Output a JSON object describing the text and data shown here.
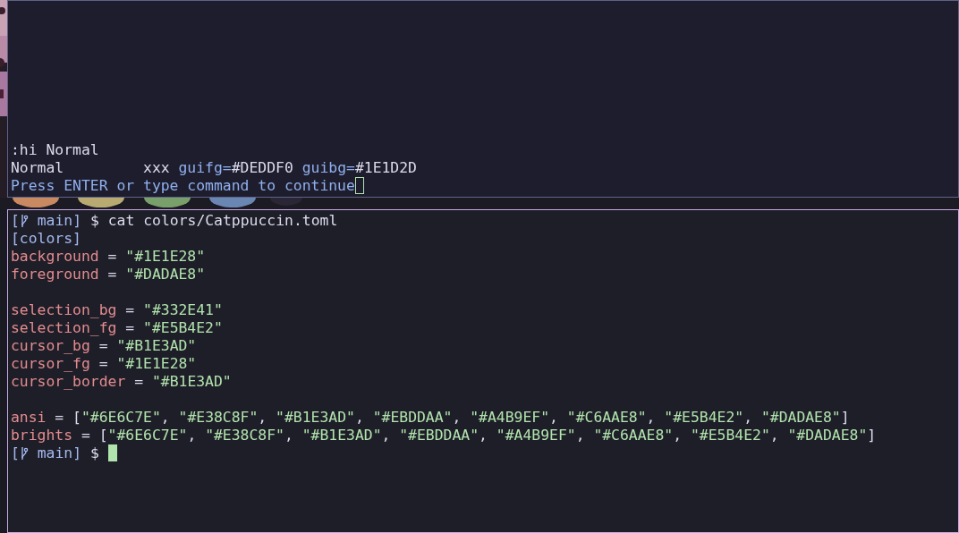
{
  "windows": [
    {
      "focused": false,
      "lines": [
        [
          {
            "kind": "plain",
            "text": ":hi Normal"
          }
        ],
        [
          {
            "kind": "plain",
            "text": "Normal         xxx "
          },
          {
            "kind": "attr",
            "text": "guifg="
          },
          {
            "kind": "plain",
            "text": "#DEDDF0 "
          },
          {
            "kind": "attr",
            "text": "guibg="
          },
          {
            "kind": "plain",
            "text": "#1E1D2D"
          }
        ],
        [
          {
            "kind": "attr",
            "text": "Press ENTER or type command to continue"
          },
          {
            "kind": "cursor"
          }
        ]
      ]
    },
    {
      "focused": true,
      "lines": [
        [
          {
            "kind": "prompt",
            "text": "["
          },
          {
            "kind": "branch"
          },
          {
            "kind": "prompt",
            "text": " main]"
          },
          {
            "kind": "plain",
            "text": " $ cat colors/Catppuccin.toml"
          }
        ],
        [
          {
            "kind": "section",
            "text": "[colors]"
          }
        ],
        [
          {
            "kind": "key",
            "text": "background"
          },
          {
            "kind": "plain",
            "text": " = "
          },
          {
            "kind": "string",
            "text": "\"#1E1E28\""
          }
        ],
        [
          {
            "kind": "key",
            "text": "foreground"
          },
          {
            "kind": "plain",
            "text": " = "
          },
          {
            "kind": "string",
            "text": "\"#DADAE8\""
          }
        ],
        [
          {
            "kind": "blank"
          }
        ],
        [
          {
            "kind": "key",
            "text": "selection_bg"
          },
          {
            "kind": "plain",
            "text": " = "
          },
          {
            "kind": "string",
            "text": "\"#332E41\""
          }
        ],
        [
          {
            "kind": "key",
            "text": "selection_fg"
          },
          {
            "kind": "plain",
            "text": " = "
          },
          {
            "kind": "string",
            "text": "\"#E5B4E2\""
          }
        ],
        [
          {
            "kind": "key",
            "text": "cursor_bg"
          },
          {
            "kind": "plain",
            "text": " = "
          },
          {
            "kind": "string",
            "text": "\"#B1E3AD\""
          }
        ],
        [
          {
            "kind": "key",
            "text": "cursor_fg"
          },
          {
            "kind": "plain",
            "text": " = "
          },
          {
            "kind": "string",
            "text": "\"#1E1E28\""
          }
        ],
        [
          {
            "kind": "key",
            "text": "cursor_border"
          },
          {
            "kind": "plain",
            "text": " = "
          },
          {
            "kind": "string",
            "text": "\"#B1E3AD\""
          }
        ],
        [
          {
            "kind": "blank"
          }
        ],
        [
          {
            "kind": "key",
            "text": "ansi"
          },
          {
            "kind": "plain",
            "text": " = ["
          },
          {
            "kind": "string",
            "text": "\"#6E6C7E\""
          },
          {
            "kind": "plain",
            "text": ", "
          },
          {
            "kind": "string",
            "text": "\"#E38C8F\""
          },
          {
            "kind": "plain",
            "text": ", "
          },
          {
            "kind": "string",
            "text": "\"#B1E3AD\""
          },
          {
            "kind": "plain",
            "text": ", "
          },
          {
            "kind": "string",
            "text": "\"#EBDDAA\""
          },
          {
            "kind": "plain",
            "text": ", "
          },
          {
            "kind": "string",
            "text": "\"#A4B9EF\""
          },
          {
            "kind": "plain",
            "text": ", "
          },
          {
            "kind": "string",
            "text": "\"#C6AAE8\""
          },
          {
            "kind": "plain",
            "text": ", "
          },
          {
            "kind": "string",
            "text": "\"#E5B4E2\""
          },
          {
            "kind": "plain",
            "text": ", "
          },
          {
            "kind": "string",
            "text": "\"#DADAE8\""
          },
          {
            "kind": "plain",
            "text": "]"
          }
        ],
        [
          {
            "kind": "key",
            "text": "brights"
          },
          {
            "kind": "plain",
            "text": " = ["
          },
          {
            "kind": "string",
            "text": "\"#6E6C7E\""
          },
          {
            "kind": "plain",
            "text": ", "
          },
          {
            "kind": "string",
            "text": "\"#E38C8F\""
          },
          {
            "kind": "plain",
            "text": ", "
          },
          {
            "kind": "string",
            "text": "\"#B1E3AD\""
          },
          {
            "kind": "plain",
            "text": ", "
          },
          {
            "kind": "string",
            "text": "\"#EBDDAA\""
          },
          {
            "kind": "plain",
            "text": ", "
          },
          {
            "kind": "string",
            "text": "\"#A4B9EF\""
          },
          {
            "kind": "plain",
            "text": ", "
          },
          {
            "kind": "string",
            "text": "\"#C6AAE8\""
          },
          {
            "kind": "plain",
            "text": ", "
          },
          {
            "kind": "string",
            "text": "\"#E5B4E2\""
          },
          {
            "kind": "plain",
            "text": ", "
          },
          {
            "kind": "string",
            "text": "\"#DADAE8\""
          },
          {
            "kind": "plain",
            "text": "]"
          }
        ],
        [
          {
            "kind": "prompt",
            "text": "["
          },
          {
            "kind": "branch"
          },
          {
            "kind": "prompt",
            "text": " main]"
          },
          {
            "kind": "plain",
            "text": " $ "
          },
          {
            "kind": "cursor"
          }
        ]
      ]
    }
  ]
}
